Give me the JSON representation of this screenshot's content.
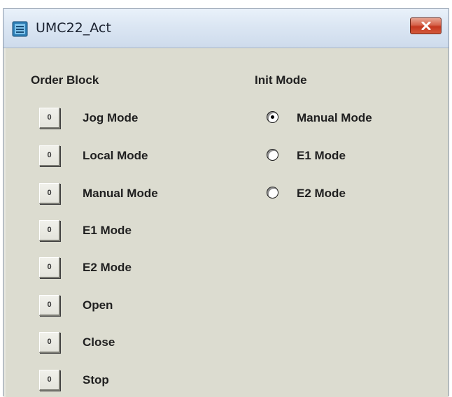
{
  "window": {
    "title": "UMC22_Act",
    "title_bar_color": "#dbe6f3",
    "close_button_color": "#c4371f",
    "body_color": "#dcdcd0"
  },
  "order_block": {
    "heading": "Order Block",
    "button_text": "0",
    "items": [
      {
        "label": "Jog Mode"
      },
      {
        "label": "Local Mode"
      },
      {
        "label": "Manual Mode"
      },
      {
        "label": "E1 Mode"
      },
      {
        "label": "E2 Mode"
      },
      {
        "label": "Open"
      },
      {
        "label": "Close"
      },
      {
        "label": "Stop"
      }
    ]
  },
  "init_mode": {
    "heading": "Init Mode",
    "options": [
      {
        "label": "Manual Mode",
        "selected": true
      },
      {
        "label": "E1 Mode",
        "selected": false
      },
      {
        "label": "E2 Mode",
        "selected": false
      }
    ]
  }
}
